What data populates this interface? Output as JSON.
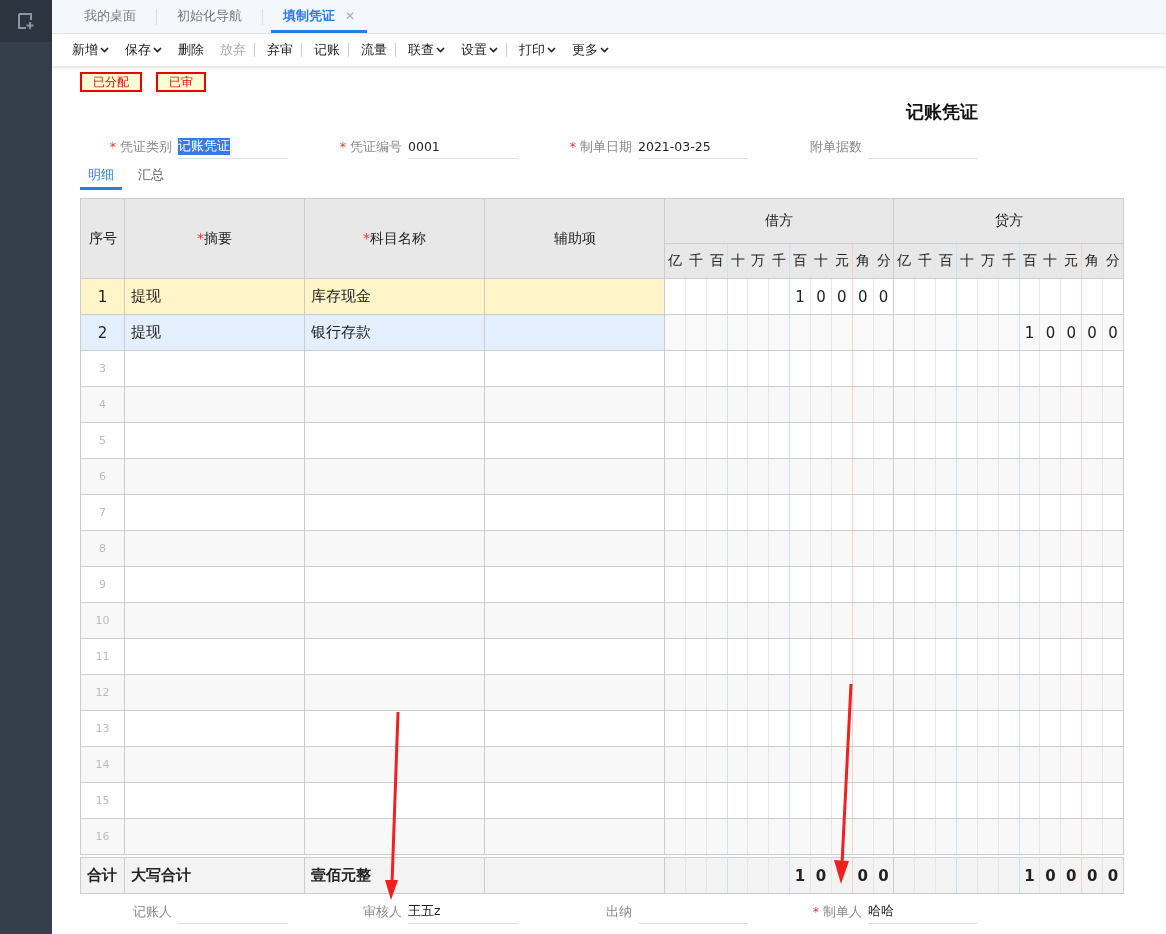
{
  "tabs": [
    {
      "label": "我的桌面",
      "selected": false,
      "closable": false
    },
    {
      "label": "初始化导航",
      "selected": false,
      "closable": false
    },
    {
      "label": "填制凭证",
      "selected": true,
      "closable": true,
      "close": "✕"
    }
  ],
  "toolbar": [
    {
      "label": "新增",
      "dropdown": true,
      "disabled": false,
      "separator_before": false
    },
    {
      "label": "保存",
      "dropdown": true,
      "disabled": false,
      "separator_before": false
    },
    {
      "label": "删除",
      "dropdown": false,
      "disabled": false,
      "separator_before": false
    },
    {
      "label": "放弃",
      "dropdown": false,
      "disabled": true,
      "separator_before": false
    },
    {
      "label": "弃审",
      "dropdown": false,
      "disabled": false,
      "separator_before": true
    },
    {
      "label": "记账",
      "dropdown": false,
      "disabled": false,
      "separator_before": true
    },
    {
      "label": "流量",
      "dropdown": false,
      "disabled": false,
      "separator_before": true
    },
    {
      "label": "联查",
      "dropdown": true,
      "disabled": false,
      "separator_before": true
    },
    {
      "label": "设置",
      "dropdown": true,
      "disabled": false,
      "separator_before": false
    },
    {
      "label": "打印",
      "dropdown": true,
      "disabled": false,
      "separator_before": true
    },
    {
      "label": "更多",
      "dropdown": true,
      "disabled": false,
      "separator_before": false
    }
  ],
  "status_badges": [
    "已分配",
    "已审"
  ],
  "voucher_title": "记账凭证",
  "header_fields": [
    {
      "label": "凭证类别",
      "required": true,
      "value": "记账凭证",
      "text_selected": true
    },
    {
      "label": "凭证编号",
      "required": true,
      "value": "0001",
      "text_selected": false
    },
    {
      "label": "制单日期",
      "required": true,
      "value": "2021-03-25",
      "text_selected": false
    },
    {
      "label": "附单据数",
      "required": false
    }
  ],
  "sub_tabs": [
    {
      "label": "明细",
      "selected": true
    },
    {
      "label": "汇总",
      "selected": false
    }
  ],
  "table": {
    "columns": [
      {
        "label": "序号",
        "required": false
      },
      {
        "label": "摘要",
        "required": true
      },
      {
        "label": "科目名称",
        "required": true
      },
      {
        "label": "辅助项",
        "required": false
      }
    ],
    "required_mark": "*",
    "amount_groups": [
      {
        "label": "借方",
        "units": [
          "亿",
          "千",
          "百",
          "十",
          "万",
          "千",
          "百",
          "十",
          "元",
          "角",
          "分"
        ]
      },
      {
        "label": "贷方",
        "units": [
          "亿",
          "千",
          "百",
          "十",
          "万",
          "千",
          "百",
          "十",
          "元",
          "角",
          "分"
        ]
      }
    ],
    "rows": [
      {
        "no": "1",
        "kind": "entry",
        "selected": true,
        "hovered": false,
        "summary": "提现",
        "account": "库存现金",
        "debit": [
          "1",
          "0",
          "0",
          "0",
          "0"
        ]
      },
      {
        "no": "2",
        "kind": "entry",
        "selected": false,
        "hovered": true,
        "summary": "提现",
        "account": "银行存款",
        "credit": [
          "1",
          "0",
          "0",
          "0",
          "0"
        ]
      },
      {
        "no": "3",
        "kind": "empty",
        "selected": false,
        "hovered": false
      },
      {
        "no": "4",
        "kind": "empty",
        "selected": false,
        "hovered": false
      },
      {
        "no": "5",
        "kind": "empty",
        "selected": false,
        "hovered": false
      },
      {
        "no": "6",
        "kind": "empty",
        "selected": false,
        "hovered": false
      },
      {
        "no": "7",
        "kind": "empty",
        "selected": false,
        "hovered": false
      },
      {
        "no": "8",
        "kind": "empty",
        "selected": false,
        "hovered": false
      },
      {
        "no": "9",
        "kind": "empty",
        "selected": false,
        "hovered": false
      },
      {
        "no": "10",
        "kind": "empty",
        "selected": false,
        "hovered": false
      },
      {
        "no": "11",
        "kind": "empty",
        "selected": false,
        "hovered": false
      },
      {
        "no": "12",
        "kind": "empty",
        "selected": false,
        "hovered": false
      },
      {
        "no": "13",
        "kind": "empty",
        "selected": false,
        "hovered": false
      },
      {
        "no": "14",
        "kind": "empty",
        "selected": false,
        "hovered": false
      },
      {
        "no": "15",
        "kind": "empty",
        "selected": false,
        "hovered": false
      },
      {
        "no": "16",
        "kind": "empty",
        "selected": false,
        "hovered": false
      }
    ],
    "total": {
      "label": "合计",
      "caption": "大写合计",
      "amount_in_words": "壹佰元整",
      "debit": [
        {
          "kind": "digit",
          "text": "1"
        },
        {
          "kind": "digit",
          "text": "0"
        },
        {
          "kind": "covered"
        },
        {
          "kind": "digit",
          "text": "0"
        },
        {
          "kind": "digit",
          "text": "0"
        }
      ],
      "credit": [
        "1",
        "0",
        "0",
        "0",
        "0"
      ]
    }
  },
  "signature_fields": [
    {
      "label": "记账人",
      "required": false
    },
    {
      "label": "审核人",
      "required": false,
      "value": "王五z"
    },
    {
      "label": "出纳",
      "required": false
    },
    {
      "label": "制单人",
      "required": true,
      "value": "哈哈"
    }
  ]
}
